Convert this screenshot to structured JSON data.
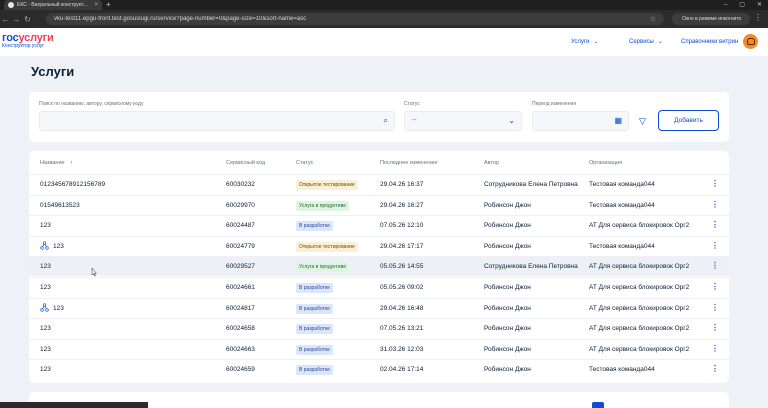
{
  "browser": {
    "tab_title": "ЕКС - Визуальный конструкт...",
    "url": "vku-test11.epgu-front.test.gosuslugi.ru/service?page-number=0&page-size=10&sort-name=asc",
    "incognito_label": "Окно в режиме инкогнито"
  },
  "header": {
    "logo_main_a": "гос",
    "logo_main_b": "услуги",
    "logo_sub": "Конструктор услуг",
    "nav": [
      {
        "label": "Услуги"
      },
      {
        "label": "Сервисы"
      },
      {
        "label": "Справочники витрин"
      }
    ]
  },
  "page": {
    "title": "Услуги"
  },
  "filters": {
    "search_label": "Поиск по названию, автору, сервисному коду",
    "search_value": "",
    "status_label": "Статус",
    "status_value": "--",
    "period_label": "Период изменения",
    "add_button": "Добавить"
  },
  "table": {
    "columns": [
      "Название",
      "Сервисный код",
      "Статус",
      "Последнее изменение",
      "Автор",
      "Организация"
    ],
    "sort_indicator": "↑",
    "rows": [
      {
        "name": "012345678912156789",
        "code": "60030232",
        "status": "Открытое тестирование",
        "status_kind": "testing",
        "changed": "29.04.26 16:37",
        "author": "Сотрудникова Елена Петровна",
        "org": "Тестовая команда044",
        "tree": false
      },
      {
        "name": "01549613523",
        "code": "60029970",
        "status": "Услуга в продуктиве",
        "status_kind": "product",
        "changed": "29.04.26 16:27",
        "author": "Робинсон Джон",
        "org": "Тестовая команда044",
        "tree": false
      },
      {
        "name": "123",
        "code": "60024487",
        "status": "В разработке",
        "status_kind": "dev",
        "changed": "07.05.26 12:10",
        "author": "Робинсон Джон",
        "org": "АТ Для сервиса блокировок Орг2",
        "tree": false
      },
      {
        "name": "123",
        "code": "60024779",
        "status": "Открытое тестирование",
        "status_kind": "testing",
        "changed": "29.04.26 17:17",
        "author": "Робинсон Джон",
        "org": "Тестовая команда044",
        "tree": true
      },
      {
        "name": "123",
        "code": "60029527",
        "status": "Услуга в продуктиве",
        "status_kind": "product",
        "changed": "05.05.26 14:55",
        "author": "Сотрудникова Елена Петровна",
        "org": "АТ Для сервиса блокировок Орг2",
        "tree": false
      },
      {
        "name": "123",
        "code": "60024661",
        "status": "В разработке",
        "status_kind": "dev",
        "changed": "05.05.26 09:02",
        "author": "Робинсон Джон",
        "org": "АТ Для сервиса блокировок Орг2",
        "tree": false
      },
      {
        "name": "123",
        "code": "60024817",
        "status": "В разработке",
        "status_kind": "dev",
        "changed": "29.04.26 16:48",
        "author": "Робинсон Джон",
        "org": "АТ Для сервиса блокировок Орг2",
        "tree": true
      },
      {
        "name": "123",
        "code": "60024658",
        "status": "В разработке",
        "status_kind": "dev",
        "changed": "07.05.26 13:21",
        "author": "Робинсон Джон",
        "org": "АТ Для сервиса блокировок Орг2",
        "tree": false
      },
      {
        "name": "123",
        "code": "60024663",
        "status": "В разработке",
        "status_kind": "dev",
        "changed": "31.03.26 12:03",
        "author": "Робинсон Джон",
        "org": "АТ Для сервиса блокировок Орг2",
        "tree": false
      },
      {
        "name": "123",
        "code": "60024659",
        "status": "В разработке",
        "status_kind": "dev",
        "changed": "02.04.26 17:14",
        "author": "Робинсон Джон",
        "org": "Тестовая команда044",
        "tree": false
      }
    ]
  },
  "colors": {
    "accent": "#0d4cd3",
    "brand_red": "#ee3f58"
  }
}
